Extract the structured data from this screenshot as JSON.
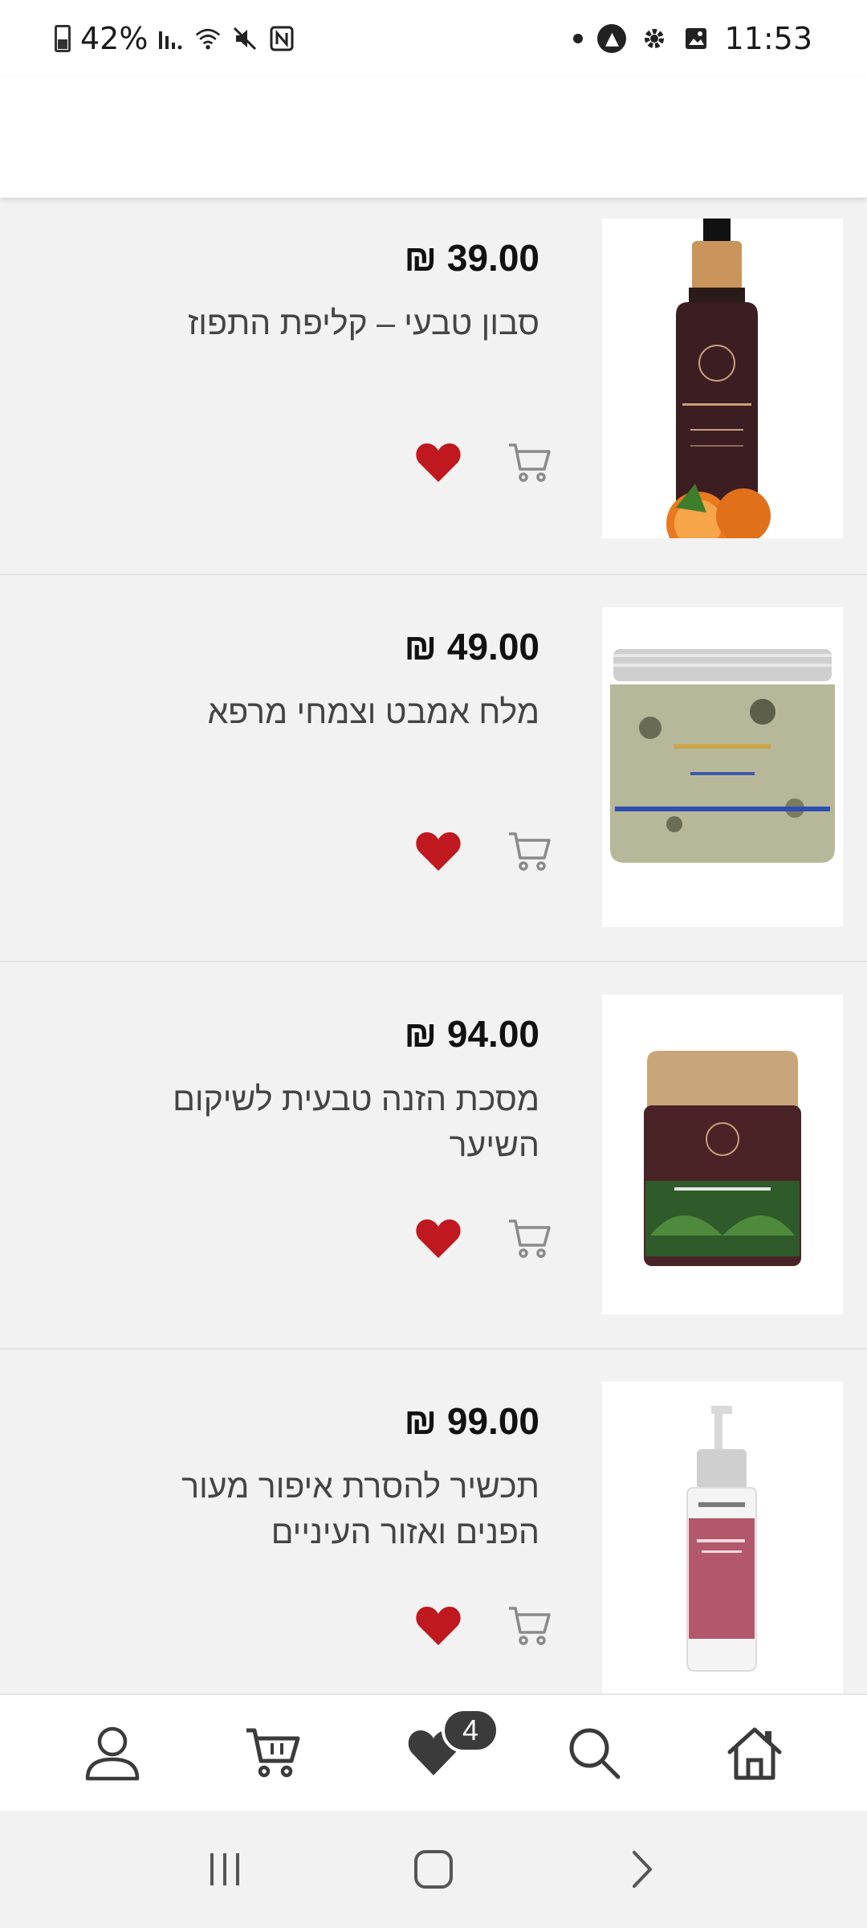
{
  "status_bar": {
    "battery": "42%",
    "time": "11:53"
  },
  "currency_symbol": "₪",
  "products": [
    {
      "price": "39.00 ₪",
      "name": "סבון טבעי – קליפת התפוז"
    },
    {
      "price": "49.00 ₪",
      "name": "מלח אמבט וצמחי מרפא"
    },
    {
      "price": "94.00 ₪",
      "name": "מסכת הזנה טבעית לשיקום השיער"
    },
    {
      "price": "99.00 ₪",
      "name": "תכשיר להסרת איפור מעור הפנים ואזור העיניים"
    }
  ],
  "bottom_nav": {
    "items": [
      "account",
      "cart",
      "wishlist",
      "search",
      "home"
    ],
    "wishlist_badge": "4"
  },
  "colors": {
    "heart": "#c0181f",
    "icon_gray": "#8a8a8a",
    "badge_bg": "#3b3b3b"
  }
}
